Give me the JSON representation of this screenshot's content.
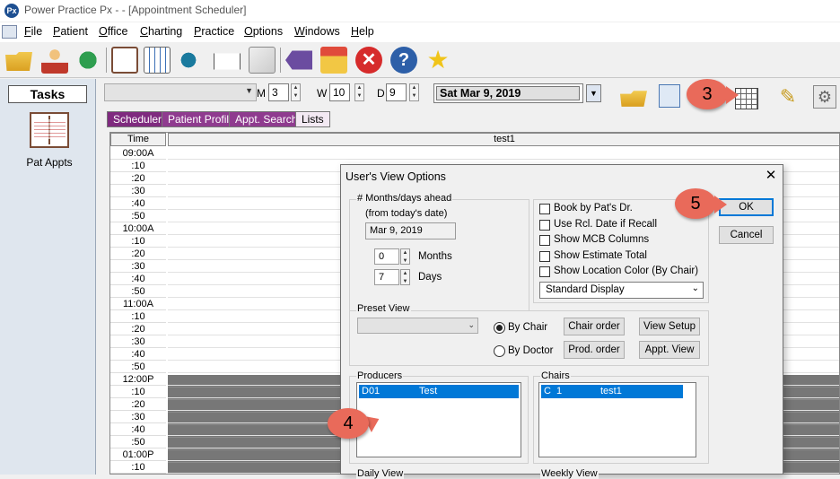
{
  "window": {
    "title": "Power Practice Px -  - [Appointment Scheduler]",
    "icon_text": "Px"
  },
  "menu": [
    "File",
    "Patient",
    "Office",
    "Charting",
    "Practice",
    "Options",
    "Windows",
    "Help"
  ],
  "tasks": {
    "header": "Tasks",
    "items": [
      {
        "label": "Pat Appts",
        "icon": "appointment-book-icon"
      }
    ]
  },
  "controls": {
    "m_label": "M",
    "m_value": "3",
    "w_label": "W",
    "w_value": "10",
    "d_label": "D",
    "d_value": "9",
    "date_value": "Sat  Mar 9, 2019"
  },
  "tabs": [
    "Scheduler",
    "Patient Profile",
    "Appt. Search",
    "Lists"
  ],
  "grid": {
    "time_header": "Time",
    "column_header": "test1",
    "times": [
      "09:00A",
      ":10",
      ":20",
      ":30",
      ":40",
      ":50",
      "10:00A",
      ":10",
      ":20",
      ":30",
      ":40",
      ":50",
      "11:00A",
      ":10",
      ":20",
      ":30",
      ":40",
      ":50",
      "12:00P",
      ":10",
      ":20",
      ":30",
      ":40",
      ":50",
      "01:00P",
      ":10"
    ]
  },
  "dialog": {
    "title": "User's View Options",
    "months_days": {
      "group_label": "# Months/days ahead",
      "sub_label": "(from today's date)",
      "date_value": "Mar 9, 2019",
      "months_value": "0",
      "months_label": "Months",
      "days_value": "7",
      "days_label": "Days"
    },
    "checkboxes": [
      "Book by Pat's Dr.",
      "Use Rcl. Date if Recall",
      "Show MCB Columns",
      "Show Estimate Total",
      "Show Location Color (By Chair)"
    ],
    "display_select": "Standard Display",
    "ok_label": "OK",
    "cancel_label": "Cancel",
    "preset": {
      "group_label": "Preset View",
      "by_chair_label": "By Chair",
      "by_doctor_label": "By Doctor",
      "chair_order_label": "Chair order",
      "view_setup_label": "View Setup",
      "prod_order_label": "Prod. order",
      "appt_view_label": "Appt. View"
    },
    "producers": {
      "group_label": "Producers",
      "rows": [
        {
          "code": "D01",
          "name": "Test"
        }
      ]
    },
    "chairs": {
      "group_label": "Chairs",
      "rows": [
        {
          "code": "C  1",
          "name": "test1"
        }
      ]
    },
    "daily_view_label": "Daily View",
    "weekly_view_label": "Weekly View"
  },
  "annotations": [
    "3",
    "4",
    "5"
  ],
  "colors": {
    "tab_active": "#7f2a7f",
    "annotation": "#e96a5a",
    "selection": "#0078d7"
  }
}
